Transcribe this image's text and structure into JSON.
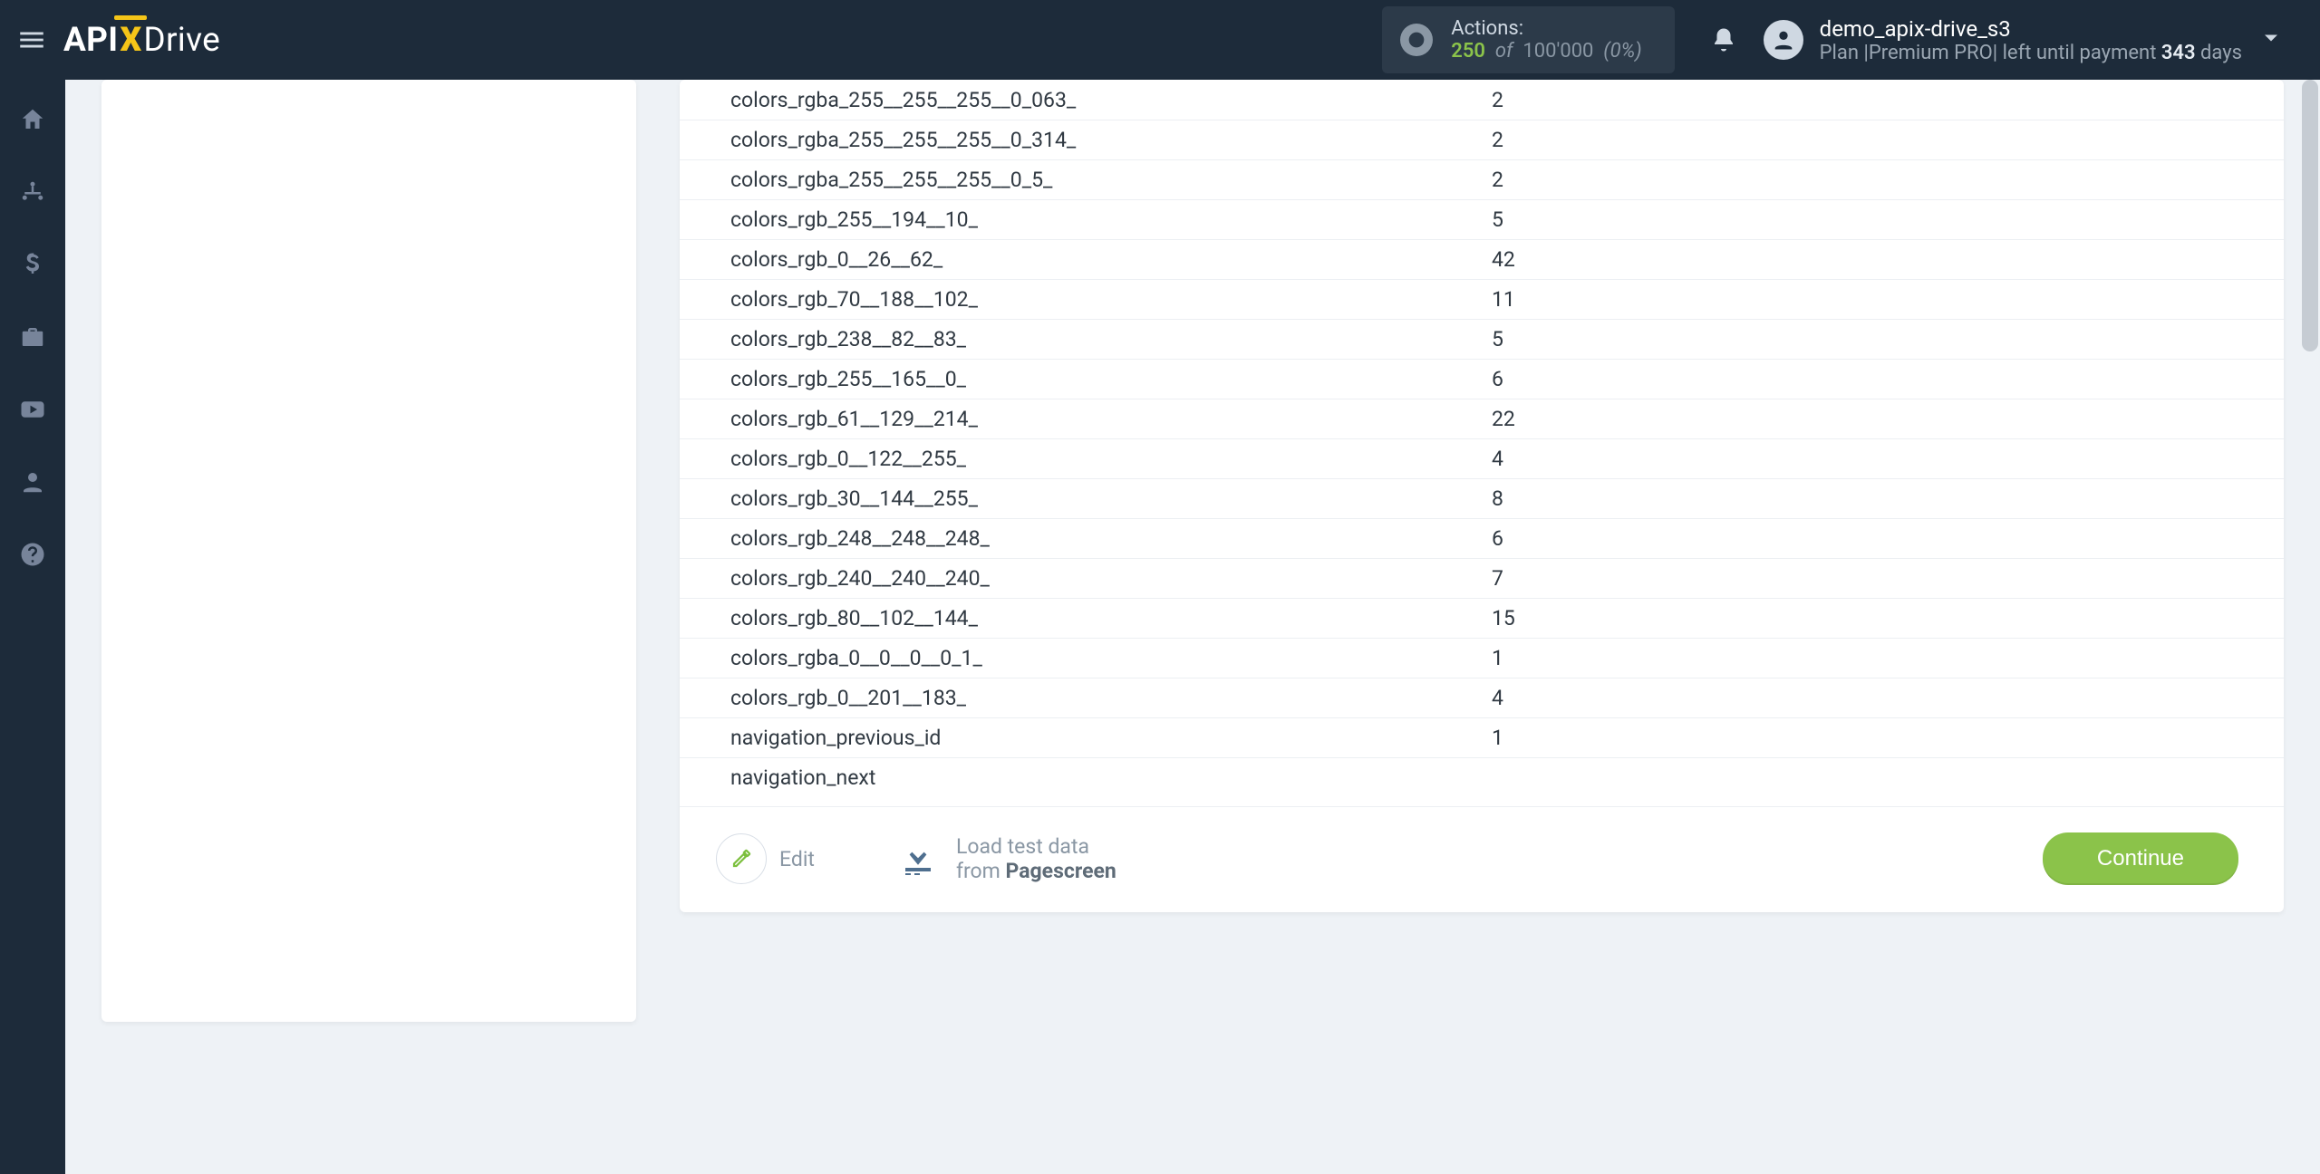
{
  "header": {
    "logo": {
      "api": "API",
      "x": "X",
      "drive": "Drive"
    },
    "actions": {
      "label": "Actions:",
      "count": "250",
      "of": "of",
      "total": "100'000",
      "pct": "(0%)"
    },
    "user": {
      "name": "demo_apix-drive_s3",
      "plan_prefix": "Plan |",
      "plan_name": "Premium PRO",
      "left_prefix": "| left until payment ",
      "days_value": "343",
      "days_suffix": " days"
    }
  },
  "sidebar": {
    "items": [
      {
        "icon": "home-icon"
      },
      {
        "icon": "connections-icon"
      },
      {
        "icon": "billing-icon"
      },
      {
        "icon": "briefcase-icon"
      },
      {
        "icon": "youtube-icon"
      },
      {
        "icon": "account-icon"
      },
      {
        "icon": "help-icon"
      }
    ]
  },
  "panel": {
    "rows": [
      {
        "key": "colors_rgba_255__255__255__0_063_",
        "val": "2"
      },
      {
        "key": "colors_rgba_255__255__255__0_314_",
        "val": "2"
      },
      {
        "key": "colors_rgba_255__255__255__0_5_",
        "val": "2"
      },
      {
        "key": "colors_rgb_255__194__10_",
        "val": "5"
      },
      {
        "key": "colors_rgb_0__26__62_",
        "val": "42"
      },
      {
        "key": "colors_rgb_70__188__102_",
        "val": "11"
      },
      {
        "key": "colors_rgb_238__82__83_",
        "val": "5"
      },
      {
        "key": "colors_rgb_255__165__0_",
        "val": "6"
      },
      {
        "key": "colors_rgb_61__129__214_",
        "val": "22"
      },
      {
        "key": "colors_rgb_0__122__255_",
        "val": "4"
      },
      {
        "key": "colors_rgb_30__144__255_",
        "val": "8"
      },
      {
        "key": "colors_rgb_248__248__248_",
        "val": "6"
      },
      {
        "key": "colors_rgb_240__240__240_",
        "val": "7"
      },
      {
        "key": "colors_rgb_80__102__144_",
        "val": "15"
      },
      {
        "key": "colors_rgba_0__0__0__0_1_",
        "val": "1"
      },
      {
        "key": "colors_rgb_0__201__183_",
        "val": "4"
      },
      {
        "key": "navigation_previous_id",
        "val": "1"
      },
      {
        "key": "navigation_next",
        "val": ""
      }
    ],
    "footer": {
      "edit": "Edit",
      "load_l1": "Load test data",
      "load_l2_prefix": "from ",
      "load_l2_bold": "Pagescreen",
      "continue": "Continue"
    }
  }
}
